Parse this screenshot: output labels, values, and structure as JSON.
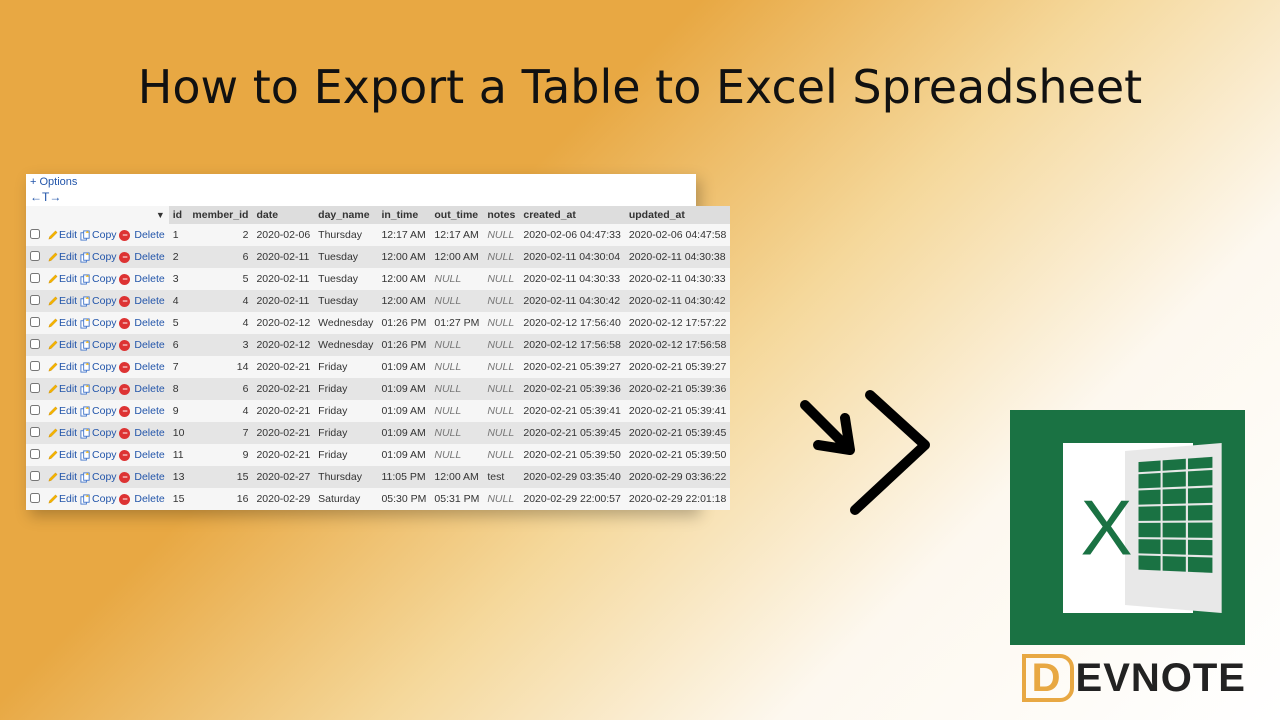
{
  "title": "How to Export a Table to Excel Spreadsheet",
  "options_label": "+ Options",
  "sort_arrows": "←T→",
  "actions": {
    "edit": "Edit",
    "copy": "Copy",
    "delete": "Delete"
  },
  "columns": [
    "id",
    "member_id",
    "date",
    "day_name",
    "in_time",
    "out_time",
    "notes",
    "created_at",
    "updated_at"
  ],
  "null_label": "NULL",
  "rows": [
    {
      "id": "1",
      "member_id": "2",
      "date": "2020-02-06",
      "day_name": "Thursday",
      "in_time": "12:17 AM",
      "out_time": "12:17 AM",
      "notes": null,
      "created_at": "2020-02-06 04:47:33",
      "updated_at": "2020-02-06 04:47:58"
    },
    {
      "id": "2",
      "member_id": "6",
      "date": "2020-02-11",
      "day_name": "Tuesday",
      "in_time": "12:00 AM",
      "out_time": "12:00 AM",
      "notes": null,
      "created_at": "2020-02-11 04:30:04",
      "updated_at": "2020-02-11 04:30:38"
    },
    {
      "id": "3",
      "member_id": "5",
      "date": "2020-02-11",
      "day_name": "Tuesday",
      "in_time": "12:00 AM",
      "out_time": null,
      "notes": null,
      "created_at": "2020-02-11 04:30:33",
      "updated_at": "2020-02-11 04:30:33"
    },
    {
      "id": "4",
      "member_id": "4",
      "date": "2020-02-11",
      "day_name": "Tuesday",
      "in_time": "12:00 AM",
      "out_time": null,
      "notes": null,
      "created_at": "2020-02-11 04:30:42",
      "updated_at": "2020-02-11 04:30:42"
    },
    {
      "id": "5",
      "member_id": "4",
      "date": "2020-02-12",
      "day_name": "Wednesday",
      "in_time": "01:26 PM",
      "out_time": "01:27 PM",
      "notes": null,
      "created_at": "2020-02-12 17:56:40",
      "updated_at": "2020-02-12 17:57:22"
    },
    {
      "id": "6",
      "member_id": "3",
      "date": "2020-02-12",
      "day_name": "Wednesday",
      "in_time": "01:26 PM",
      "out_time": null,
      "notes": null,
      "created_at": "2020-02-12 17:56:58",
      "updated_at": "2020-02-12 17:56:58"
    },
    {
      "id": "7",
      "member_id": "14",
      "date": "2020-02-21",
      "day_name": "Friday",
      "in_time": "01:09 AM",
      "out_time": null,
      "notes": null,
      "created_at": "2020-02-21 05:39:27",
      "updated_at": "2020-02-21 05:39:27"
    },
    {
      "id": "8",
      "member_id": "6",
      "date": "2020-02-21",
      "day_name": "Friday",
      "in_time": "01:09 AM",
      "out_time": null,
      "notes": null,
      "created_at": "2020-02-21 05:39:36",
      "updated_at": "2020-02-21 05:39:36"
    },
    {
      "id": "9",
      "member_id": "4",
      "date": "2020-02-21",
      "day_name": "Friday",
      "in_time": "01:09 AM",
      "out_time": null,
      "notes": null,
      "created_at": "2020-02-21 05:39:41",
      "updated_at": "2020-02-21 05:39:41"
    },
    {
      "id": "10",
      "member_id": "7",
      "date": "2020-02-21",
      "day_name": "Friday",
      "in_time": "01:09 AM",
      "out_time": null,
      "notes": null,
      "created_at": "2020-02-21 05:39:45",
      "updated_at": "2020-02-21 05:39:45"
    },
    {
      "id": "11",
      "member_id": "9",
      "date": "2020-02-21",
      "day_name": "Friday",
      "in_time": "01:09 AM",
      "out_time": null,
      "notes": null,
      "created_at": "2020-02-21 05:39:50",
      "updated_at": "2020-02-21 05:39:50"
    },
    {
      "id": "13",
      "member_id": "15",
      "date": "2020-02-27",
      "day_name": "Thursday",
      "in_time": "11:05 PM",
      "out_time": "12:00 AM",
      "notes": "test",
      "created_at": "2020-02-29 03:35:40",
      "updated_at": "2020-02-29 03:36:22"
    },
    {
      "id": "15",
      "member_id": "16",
      "date": "2020-02-29",
      "day_name": "Saturday",
      "in_time": "05:30 PM",
      "out_time": "05:31 PM",
      "notes": null,
      "created_at": "2020-02-29 22:00:57",
      "updated_at": "2020-02-29 22:01:18"
    }
  ],
  "brand": {
    "letter": "D",
    "rest": "EVNOTE"
  }
}
